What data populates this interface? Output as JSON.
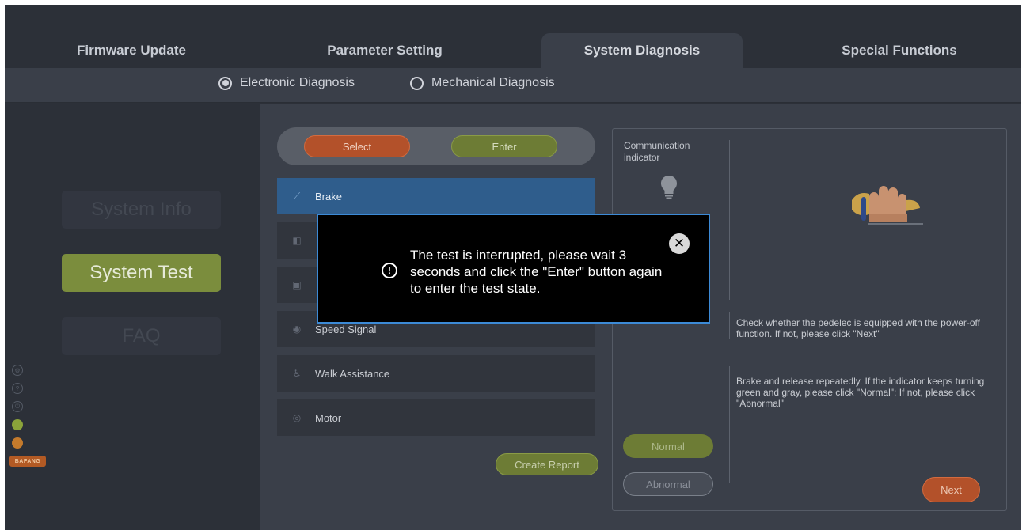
{
  "tabs": [
    {
      "label": "Firmware Update"
    },
    {
      "label": "Parameter Setting"
    },
    {
      "label": "System Diagnosis"
    },
    {
      "label": "Special Functions"
    }
  ],
  "diagnosis_modes": [
    {
      "label": "Electronic Diagnosis",
      "selected": true
    },
    {
      "label": "Mechanical Diagnosis",
      "selected": false
    }
  ],
  "nav": [
    {
      "label": "System Info"
    },
    {
      "label": "System Test"
    },
    {
      "label": "FAQ"
    }
  ],
  "sidebar_icons": [
    "settings-icon",
    "help-icon",
    "power-icon",
    "user-icon",
    "device-icon"
  ],
  "brand": {
    "text": "BAFANG"
  },
  "toolbar": {
    "select_label": "Select",
    "enter_label": "Enter"
  },
  "test_items": [
    {
      "label": "Brake",
      "icon": "brake-icon"
    },
    {
      "label": "",
      "icon": "light-icon"
    },
    {
      "label": "",
      "icon": "display-icon"
    },
    {
      "label": "Speed Signal",
      "icon": "speed-signal-icon"
    },
    {
      "label": "Walk Assistance",
      "icon": "walk-assist-icon"
    },
    {
      "label": "Motor",
      "icon": "motor-icon"
    }
  ],
  "report": {
    "label": "Create Report"
  },
  "panel": {
    "indicator_label": "Communication indicator",
    "instruction_1": "Check whether the pedelec is equipped with the power-off function. If not, please click \"Next\"",
    "instruction_2": "Brake and release repeatedly. If the indicator keeps turning green and gray, please click \"Normal\"; If not, please click \"Abnormal\"",
    "normal_label": "Normal",
    "abnormal_label": "Abnormal",
    "next_label": "Next"
  },
  "modal": {
    "message": "The test is interrupted, please wait 3 seconds and click the \"Enter\" button again to enter the test state."
  },
  "colors": {
    "accent_green": "#7b8d3d",
    "accent_orange": "#b3512a",
    "selection_blue": "#2f5d8c",
    "modal_border": "#3c8ad6"
  }
}
